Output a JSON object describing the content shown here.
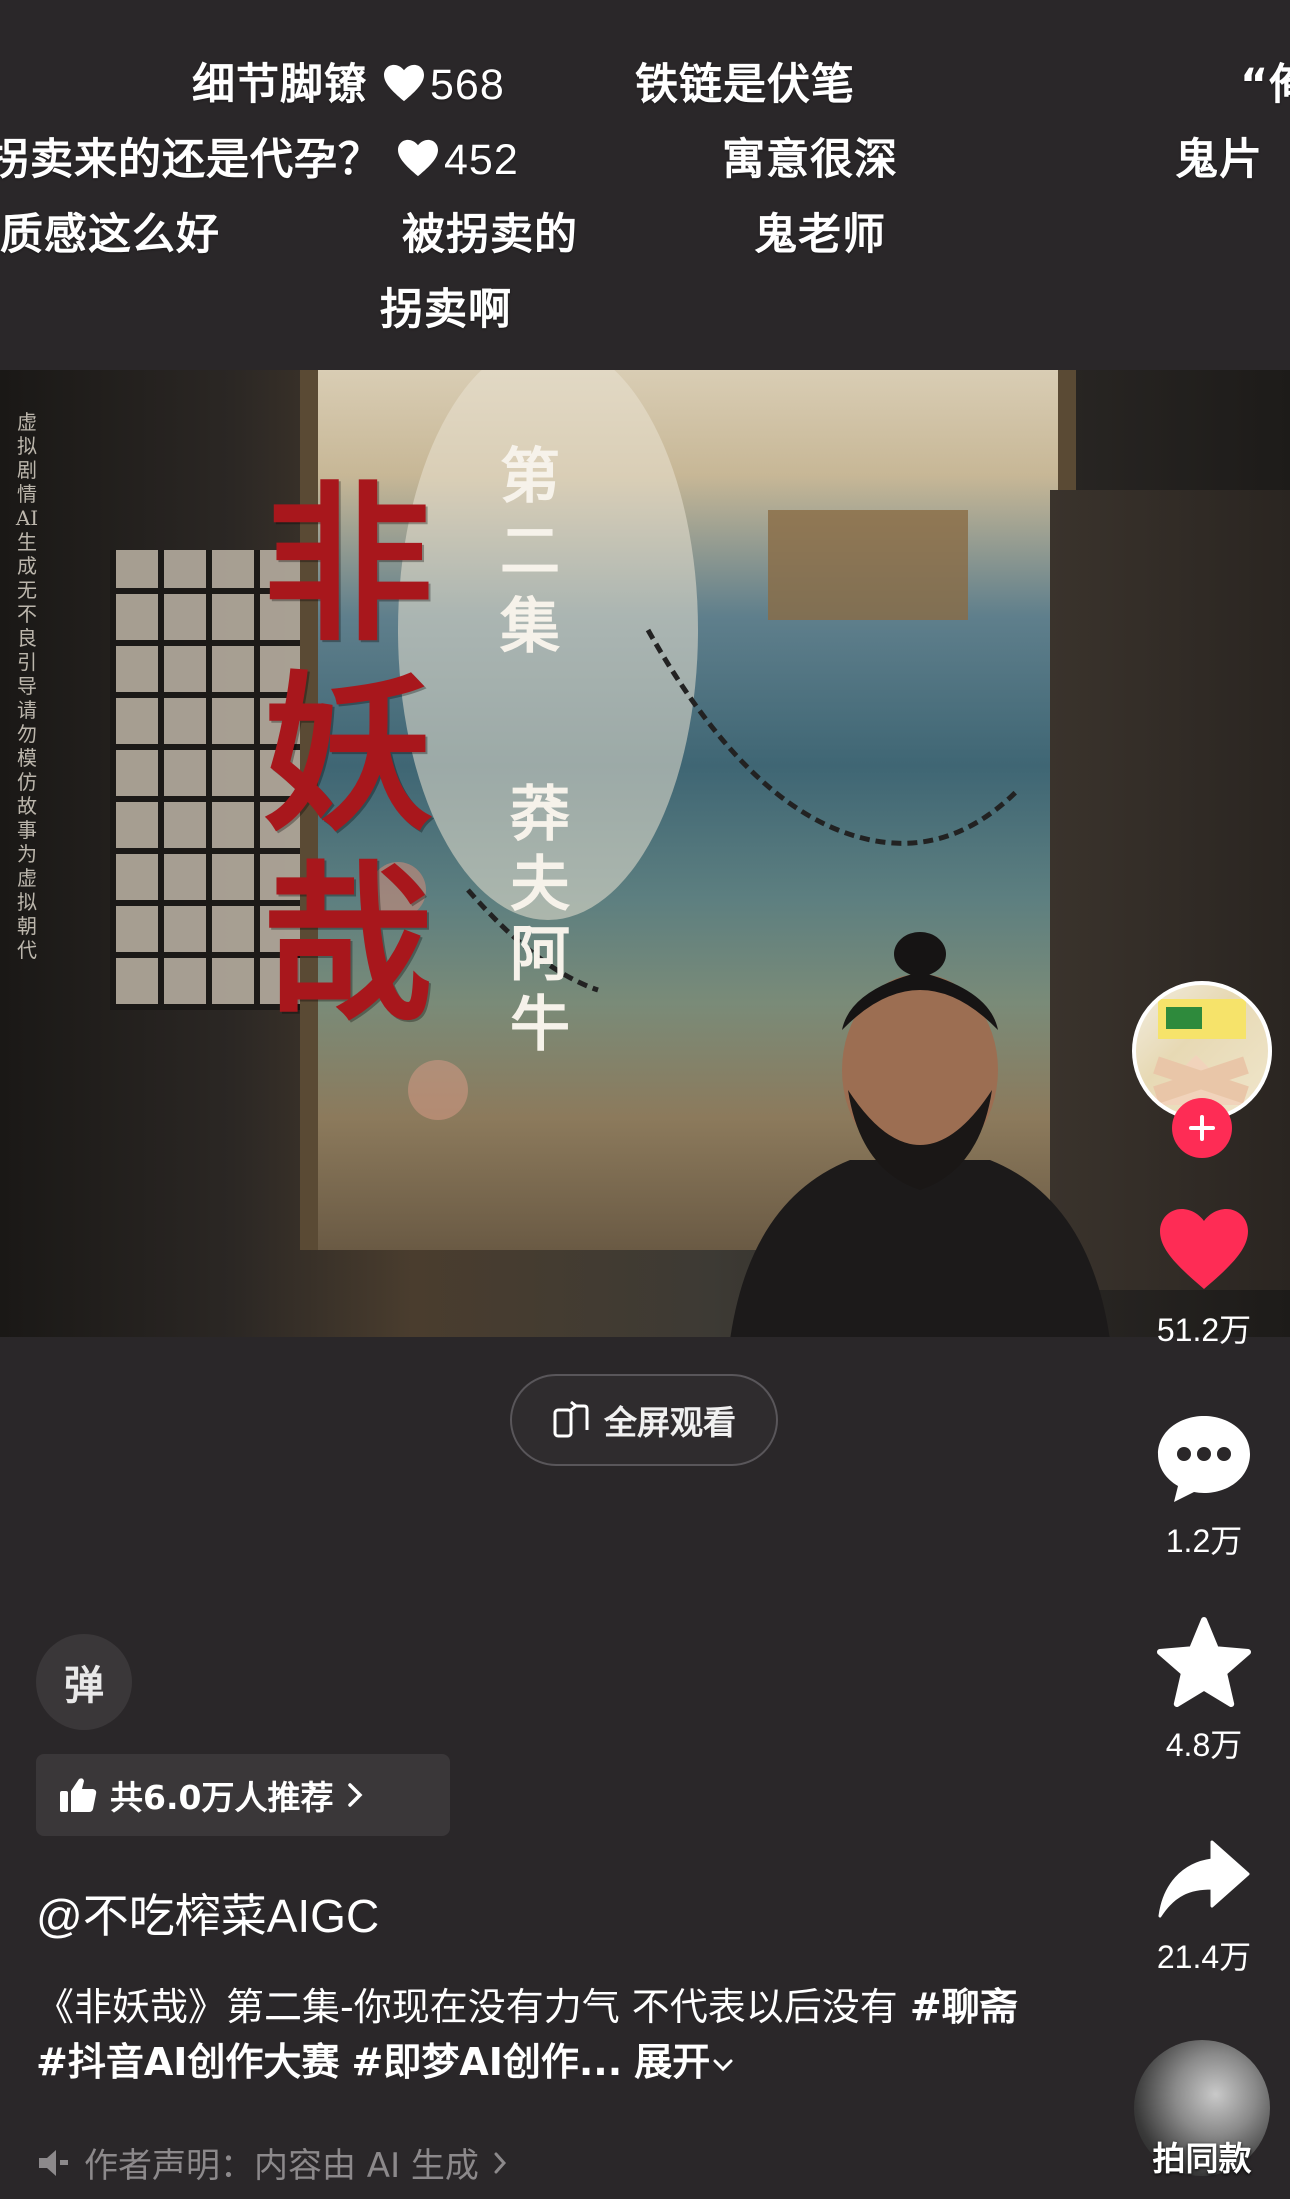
{
  "danmaku": [
    {
      "text": "细节脚镣",
      "likes": "568"
    },
    {
      "text": "铁链是伏笔"
    },
    {
      "text": "“俺"
    },
    {
      "text": "拐卖来的还是代孕？",
      "likes": "452"
    },
    {
      "text": "寓意很深"
    },
    {
      "text": "鬼片"
    },
    {
      "text": "质感这么好"
    },
    {
      "text": "被拐卖的"
    },
    {
      "text": "鬼老师"
    },
    {
      "text": "拐卖啊"
    }
  ],
  "video": {
    "main_title": "非妖哉",
    "episode": "第二集",
    "subtitle": "莽夫阿牛",
    "disclaimer": "虚拟剧情 AI生成 无不良引导 请勿模仿 故事为虚拟朝代",
    "fullscreen_label": "全屏观看"
  },
  "actions": {
    "likes": "51.2万",
    "comments": "1.2万",
    "favorites": "4.8万",
    "shares": "21.4万",
    "remix_label": "拍同款",
    "like_color": "#fe2c55"
  },
  "bottom": {
    "danmu_toggle": "弹",
    "recommend": "共6.0万人推荐",
    "author": "@不吃榨菜AIGC",
    "description_text": "《非妖哉》第二集-你现在没有力气 不代表以后没有",
    "tags": [
      "#聊斋",
      "#抖音AI创作大赛",
      "#即梦AI创作..."
    ],
    "expand": "展开",
    "claim": "作者声明：内容由 AI 生成"
  }
}
